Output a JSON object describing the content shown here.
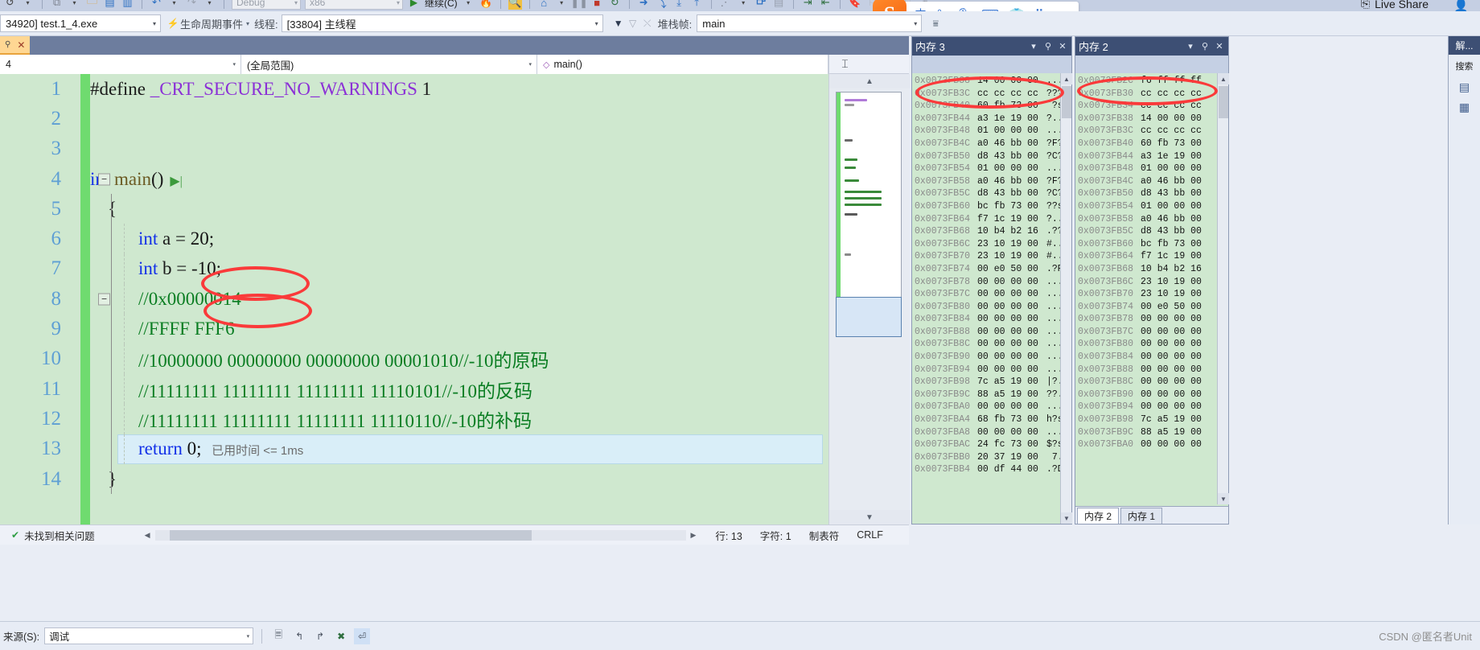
{
  "window": {
    "live_share": "Live Share"
  },
  "toolbar": {
    "config": "Debug",
    "platform": "x86",
    "continue_label": "继续(C)",
    "icons": [
      "undo-icon",
      "redo-icon",
      "save-icon",
      "save-all-icon",
      "open-file-icon",
      "copy-icon",
      "search-icon",
      "home-icon",
      "pause-icon",
      "stop-icon",
      "restart-icon",
      "step-over-icon",
      "step-into-icon",
      "step-out-icon",
      "next-statement-icon",
      "threads-icon",
      "window-icon",
      "indent-icon",
      "outdent-icon",
      "bookmark-icon"
    ]
  },
  "debug_bar": {
    "process_label": "34920] test.1_4.exe",
    "lifecycle_events": "生命周期事件",
    "thread_label": "线程:",
    "thread_value": "[33804] 主线程",
    "stackframe_label": "堆栈帧:",
    "stackframe_value": "main"
  },
  "ime": {
    "logo": "S",
    "mode": "中",
    "icons": [
      "punctuation-icon",
      "voice-input-icon",
      "keyboard-icon",
      "skin-icon",
      "apps-icon"
    ]
  },
  "editor": {
    "tab_title": "",
    "nav_file": "4",
    "nav_scope": "(全局范围)",
    "nav_member": "main()",
    "lines": [
      {
        "no": "1",
        "segments": [
          {
            "t": "#define ",
            "c": "plain"
          },
          {
            "t": "_CRT_SECURE_NO_WARNINGS",
            "c": "mac"
          },
          {
            "t": " 1",
            "c": "plain"
          }
        ],
        "indent": 0
      },
      {
        "no": "2",
        "segments": [],
        "indent": 0
      },
      {
        "no": "3",
        "segments": [],
        "indent": 0
      },
      {
        "no": "4",
        "segments": [
          {
            "t": "int ",
            "c": "kw"
          },
          {
            "t": "main",
            "c": "fn"
          },
          {
            "t": "()",
            "c": "plain"
          }
        ],
        "indent": 0,
        "fold": true,
        "runarrow": true
      },
      {
        "no": "5",
        "segments": [
          {
            "t": "{",
            "c": "plain"
          }
        ],
        "indent": 1
      },
      {
        "no": "6",
        "segments": [
          {
            "t": "int ",
            "c": "kw"
          },
          {
            "t": "a = ",
            "c": "plain"
          },
          {
            "t": "20",
            "c": "num"
          },
          {
            "t": ";",
            "c": "plain"
          }
        ],
        "indent": 2
      },
      {
        "no": "7",
        "segments": [
          {
            "t": "int ",
            "c": "kw"
          },
          {
            "t": "b = -",
            "c": "plain"
          },
          {
            "t": "10",
            "c": "num"
          },
          {
            "t": ";",
            "c": "plain"
          }
        ],
        "indent": 2
      },
      {
        "no": "8",
        "segments": [
          {
            "t": "//0x00000014",
            "c": "cm"
          }
        ],
        "indent": 2,
        "fold": true
      },
      {
        "no": "9",
        "segments": [
          {
            "t": "//FFFF FFF6",
            "c": "cm"
          }
        ],
        "indent": 2
      },
      {
        "no": "10",
        "segments": [
          {
            "t": "//10000000 00000000 00000000 00001010//-10的原码",
            "c": "cm"
          }
        ],
        "indent": 2
      },
      {
        "no": "11",
        "segments": [
          {
            "t": "//11111111 11111111 11111111 11110101//-10的反码",
            "c": "cm"
          }
        ],
        "indent": 2
      },
      {
        "no": "12",
        "segments": [
          {
            "t": "//11111111 11111111 11111111 11110110//-10的补码",
            "c": "cm"
          }
        ],
        "indent": 2
      },
      {
        "no": "13",
        "segments": [
          {
            "t": "return ",
            "c": "kw"
          },
          {
            "t": "0",
            "c": "num"
          },
          {
            "t": ";",
            "c": "plain"
          }
        ],
        "indent": 2,
        "current": true,
        "elapsed": "已用时间 <= 1ms"
      },
      {
        "no": "14",
        "segments": [
          {
            "t": "}",
            "c": "plain"
          }
        ],
        "indent": 1
      }
    ]
  },
  "status_bar": {
    "problem_text": "未找到相关问题",
    "line": "行: 13",
    "char": "字符: 1",
    "tabmode": "制表符",
    "eol": "CRLF"
  },
  "memory3": {
    "title": "内存 3",
    "rows": [
      {
        "addr": "0x0073FB38",
        "bytes": "14 00 00 00",
        "ascii": "...."
      },
      {
        "addr": "0x0073FB3C",
        "bytes": "cc cc cc cc",
        "ascii": "????"
      },
      {
        "addr": "0x0073FB40",
        "bytes": "60 fb 73 00",
        "ascii": "`?s."
      },
      {
        "addr": "0x0073FB44",
        "bytes": "a3 1e 19 00",
        "ascii": "?..."
      },
      {
        "addr": "0x0073FB48",
        "bytes": "01 00 00 00",
        "ascii": "...."
      },
      {
        "addr": "0x0073FB4C",
        "bytes": "a0 46 bb 00",
        "ascii": "?F?."
      },
      {
        "addr": "0x0073FB50",
        "bytes": "d8 43 bb 00",
        "ascii": "?C?."
      },
      {
        "addr": "0x0073FB54",
        "bytes": "01 00 00 00",
        "ascii": "...."
      },
      {
        "addr": "0x0073FB58",
        "bytes": "a0 46 bb 00",
        "ascii": "?F?."
      },
      {
        "addr": "0x0073FB5C",
        "bytes": "d8 43 bb 00",
        "ascii": "?C?."
      },
      {
        "addr": "0x0073FB60",
        "bytes": "bc fb 73 00",
        "ascii": "??s."
      },
      {
        "addr": "0x0073FB64",
        "bytes": "f7 1c 19 00",
        "ascii": "?..."
      },
      {
        "addr": "0x0073FB68",
        "bytes": "10 b4 b2 16",
        "ascii": ".??."
      },
      {
        "addr": "0x0073FB6C",
        "bytes": "23 10 19 00",
        "ascii": "#..."
      },
      {
        "addr": "0x0073FB70",
        "bytes": "23 10 19 00",
        "ascii": "#..."
      },
      {
        "addr": "0x0073FB74",
        "bytes": "00 e0 50 00",
        "ascii": ".?P."
      },
      {
        "addr": "0x0073FB78",
        "bytes": "00 00 00 00",
        "ascii": "...."
      },
      {
        "addr": "0x0073FB7C",
        "bytes": "00 00 00 00",
        "ascii": "...."
      },
      {
        "addr": "0x0073FB80",
        "bytes": "00 00 00 00",
        "ascii": "...."
      },
      {
        "addr": "0x0073FB84",
        "bytes": "00 00 00 00",
        "ascii": "...."
      },
      {
        "addr": "0x0073FB88",
        "bytes": "00 00 00 00",
        "ascii": "...."
      },
      {
        "addr": "0x0073FB8C",
        "bytes": "00 00 00 00",
        "ascii": "...."
      },
      {
        "addr": "0x0073FB90",
        "bytes": "00 00 00 00",
        "ascii": "...."
      },
      {
        "addr": "0x0073FB94",
        "bytes": "00 00 00 00",
        "ascii": "...."
      },
      {
        "addr": "0x0073FB98",
        "bytes": "7c a5 19 00",
        "ascii": "|?.."
      },
      {
        "addr": "0x0073FB9C",
        "bytes": "88 a5 19 00",
        "ascii": "??.."
      },
      {
        "addr": "0x0073FBA0",
        "bytes": "00 00 00 00",
        "ascii": "...."
      },
      {
        "addr": "0x0073FBA4",
        "bytes": "68 fb 73 00",
        "ascii": "h?s."
      },
      {
        "addr": "0x0073FBA8",
        "bytes": "00 00 00 00",
        "ascii": "...."
      },
      {
        "addr": "0x0073FBAC",
        "bytes": "24 fc 73 00",
        "ascii": "$?s."
      },
      {
        "addr": "0x0073FBB0",
        "bytes": "20 37 19 00",
        "ascii": " 7.."
      },
      {
        "addr": "0x0073FBB4",
        "bytes": "00 df 44 00",
        "ascii": ".?D."
      }
    ]
  },
  "memory2": {
    "title": "内存 2",
    "rows": [
      {
        "addr": "0x0073FB2C",
        "bytes": "f6 ff ff ff"
      },
      {
        "addr": "0x0073FB30",
        "bytes": "cc cc cc cc"
      },
      {
        "addr": "0x0073FB34",
        "bytes": "cc cc cc cc"
      },
      {
        "addr": "0x0073FB38",
        "bytes": "14 00 00 00"
      },
      {
        "addr": "0x0073FB3C",
        "bytes": "cc cc cc cc"
      },
      {
        "addr": "0x0073FB40",
        "bytes": "60 fb 73 00"
      },
      {
        "addr": "0x0073FB44",
        "bytes": "a3 1e 19 00"
      },
      {
        "addr": "0x0073FB48",
        "bytes": "01 00 00 00"
      },
      {
        "addr": "0x0073FB4C",
        "bytes": "a0 46 bb 00"
      },
      {
        "addr": "0x0073FB50",
        "bytes": "d8 43 bb 00"
      },
      {
        "addr": "0x0073FB54",
        "bytes": "01 00 00 00"
      },
      {
        "addr": "0x0073FB58",
        "bytes": "a0 46 bb 00"
      },
      {
        "addr": "0x0073FB5C",
        "bytes": "d8 43 bb 00"
      },
      {
        "addr": "0x0073FB60",
        "bytes": "bc fb 73 00"
      },
      {
        "addr": "0x0073FB64",
        "bytes": "f7 1c 19 00"
      },
      {
        "addr": "0x0073FB68",
        "bytes": "10 b4 b2 16"
      },
      {
        "addr": "0x0073FB6C",
        "bytes": "23 10 19 00"
      },
      {
        "addr": "0x0073FB70",
        "bytes": "23 10 19 00"
      },
      {
        "addr": "0x0073FB74",
        "bytes": "00 e0 50 00"
      },
      {
        "addr": "0x0073FB78",
        "bytes": "00 00 00 00"
      },
      {
        "addr": "0x0073FB7C",
        "bytes": "00 00 00 00"
      },
      {
        "addr": "0x0073FB80",
        "bytes": "00 00 00 00"
      },
      {
        "addr": "0x0073FB84",
        "bytes": "00 00 00 00"
      },
      {
        "addr": "0x0073FB88",
        "bytes": "00 00 00 00"
      },
      {
        "addr": "0x0073FB8C",
        "bytes": "00 00 00 00"
      },
      {
        "addr": "0x0073FB90",
        "bytes": "00 00 00 00"
      },
      {
        "addr": "0x0073FB94",
        "bytes": "00 00 00 00"
      },
      {
        "addr": "0x0073FB98",
        "bytes": "7c a5 19 00"
      },
      {
        "addr": "0x0073FB9C",
        "bytes": "88 a5 19 00"
      },
      {
        "addr": "0x0073FBA0",
        "bytes": "00 00 00 00"
      }
    ],
    "tabs": [
      {
        "label": "内存 2",
        "active": true
      },
      {
        "label": "内存 1",
        "active": false
      }
    ]
  },
  "right_panel": {
    "title": "解...",
    "search": "搜索"
  },
  "bottom": {
    "source_label": "来源(S):",
    "source_value": "调试"
  },
  "watermark": "CSDN @匿名者Unit"
}
